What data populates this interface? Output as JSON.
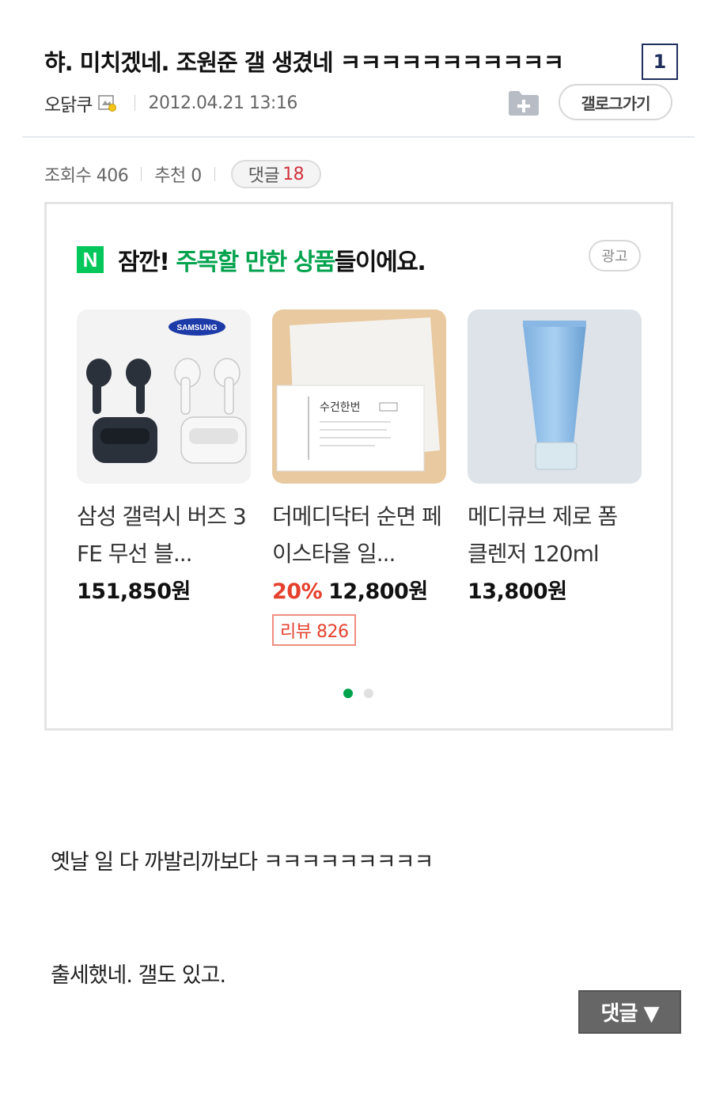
{
  "post": {
    "title": "햐. 미치겠네. 조원준 갤 생겼네 ㅋㅋㅋㅋㅋㅋㅋㅋㅋㅋㅋ",
    "page_badge": "1",
    "author": "오닭쿠",
    "date": "2012.04.21 13:16",
    "gallery_button": "갤로그가기",
    "views_label": "조회수 406",
    "recommend_label": "추천 0",
    "comment_label": "댓글",
    "comment_count": "18",
    "body_lines": [
      "옛날 일 다 까발리까보다 ㅋㅋㅋㅋㅋㅋㅋㅋㅋ",
      "출세했네. 갤도 있고."
    ],
    "reply_button": "댓글 ▼"
  },
  "ad": {
    "logo": "N",
    "headline_prefix": "잠깐! ",
    "headline_highlight": "주목할 만한 상품",
    "headline_suffix": "들이에요.",
    "badge": "광고",
    "products": [
      {
        "name": "삼성 갤럭시 버즈 3 FE 무선 블...",
        "discount": "",
        "price": "151,850원",
        "review": "",
        "brand_logo": "SAMSUNG",
        "icon": "earbuds-image"
      },
      {
        "name": "더메디닥터 순면 페이스타올 일...",
        "discount": "20%",
        "price": "12,800원",
        "review": "리뷰 826",
        "box_label": "수건한번",
        "icon": "face-towel-image"
      },
      {
        "name": "메디큐브 제로 폼 클렌저 120ml",
        "discount": "",
        "price": "13,800원",
        "review": "",
        "icon": "cleanser-tube-image"
      }
    ],
    "carousel": {
      "current_page": 1,
      "total_pages": 2
    }
  },
  "colors": {
    "brand_green": "#03c75a",
    "discount_red": "#e5412e",
    "comment_count_red": "#d0323f"
  }
}
